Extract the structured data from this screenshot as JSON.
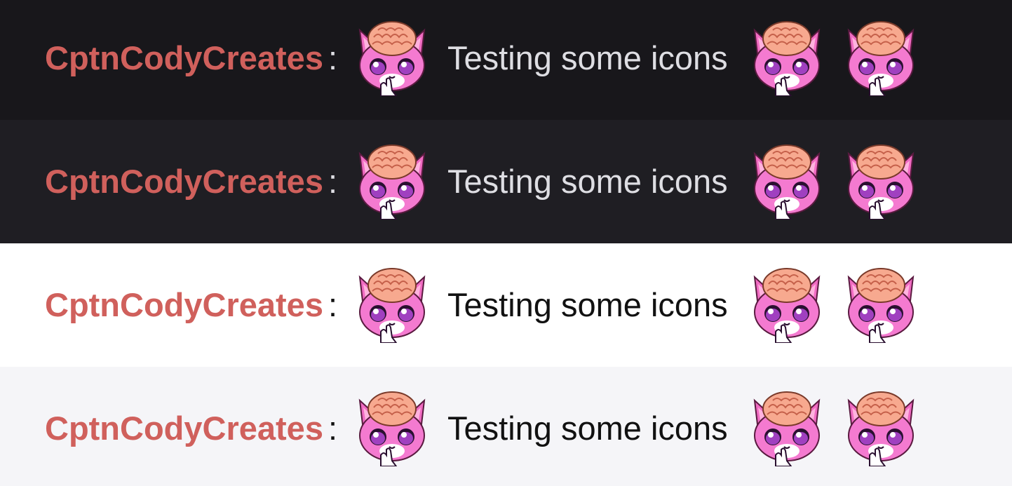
{
  "colors": {
    "username": "#d0605c",
    "emote_body": "#f472c9",
    "emote_brain": "#f7a98f"
  },
  "emote_name": "brain-cat-emote",
  "rows": [
    {
      "theme": "dark",
      "bg": "#18171b",
      "text_color": "#dedee3",
      "colon_color": "#dedee3",
      "username": "CptnCodyCreates",
      "separator": ":",
      "message": "Testing some icons"
    },
    {
      "theme": "dark-alt",
      "bg": "#1f1e23",
      "text_color": "#dedee3",
      "colon_color": "#dedee3",
      "username": "CptnCodyCreates",
      "separator": ":",
      "message": "Testing some icons"
    },
    {
      "theme": "light",
      "bg": "#ffffff",
      "text_color": "#111111",
      "colon_color": "#111111",
      "username": "CptnCodyCreates",
      "separator": ":",
      "message": "Testing some icons"
    },
    {
      "theme": "light-alt",
      "bg": "#f5f5f8",
      "text_color": "#111111",
      "colon_color": "#111111",
      "username": "CptnCodyCreates",
      "separator": ":",
      "message": "Testing some icons"
    }
  ]
}
